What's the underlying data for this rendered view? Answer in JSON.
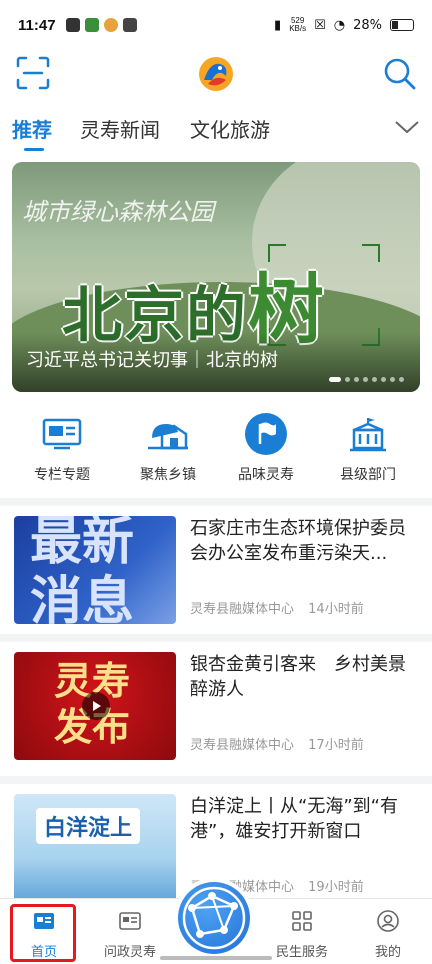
{
  "status_bar": {
    "time": "11:47",
    "net_speed_value": "529",
    "net_speed_unit": "KB/s",
    "battery": "28%"
  },
  "header": {
    "scan_icon": "scan-icon",
    "logo": "app-logo",
    "search_icon": "search-icon"
  },
  "tabs": [
    {
      "label": "推荐",
      "active": true
    },
    {
      "label": "灵寿新闻",
      "active": false
    },
    {
      "label": "文化旅游",
      "active": false
    }
  ],
  "banner": {
    "script_text": "城市绿心森林公园",
    "headline": "北京的",
    "headline_accent": "树",
    "caption": "习近平总书记关切事｜北京的树",
    "slide_count": 8,
    "active_slide": 1
  },
  "quick_links": [
    {
      "label": "专栏专题",
      "icon": "column-icon"
    },
    {
      "label": "聚焦乡镇",
      "icon": "town-icon"
    },
    {
      "label": "品味灵寿",
      "icon": "flag-icon"
    },
    {
      "label": "县级部门",
      "icon": "government-building-icon"
    }
  ],
  "news": [
    {
      "title": "石家庄市生态环境保护委员会办公室发布重污染天...",
      "source": "灵寿县融媒体中心",
      "time": "14小时前",
      "thumb_text": "最新消息"
    },
    {
      "title": "银杏金黄引客来　乡村美景醉游人",
      "source": "灵寿县融媒体中心",
      "time": "17小时前",
      "thumb_text": "灵寿发布"
    },
    {
      "title": "白洋淀上丨从“无海”到“有港”，雄安打开新窗口",
      "source": "灵寿县融媒体中心",
      "time": "19小时前",
      "thumb_text": "白洋淀上"
    }
  ],
  "bottom_nav": [
    {
      "label": "首页",
      "active": true
    },
    {
      "label": "问政灵寿",
      "active": false
    },
    {
      "label": "",
      "active": false
    },
    {
      "label": "民生服务",
      "active": false
    },
    {
      "label": "我的",
      "active": false
    }
  ],
  "colors": {
    "accent": "#1a7fd4",
    "highlight": "#e5191f"
  }
}
